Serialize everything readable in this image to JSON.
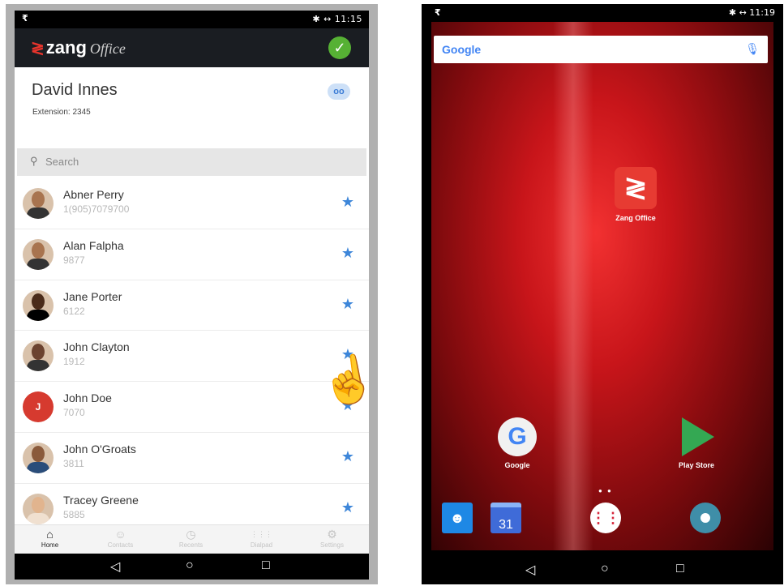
{
  "left_phone": {
    "status_time": "11:15",
    "status_icons": "✱ ↔",
    "app_logo": "zang",
    "app_logo_suffix": "Office",
    "profile": {
      "name": "David Innes",
      "extension": "Extension: 2345",
      "voicemail_icon": "oo"
    },
    "search_placeholder": "Search",
    "contacts": [
      {
        "name": "Abner Perry",
        "number": "1(905)7079700",
        "avatar": "photo"
      },
      {
        "name": "Alan Falpha",
        "number": "9877",
        "avatar": "photo"
      },
      {
        "name": "Jane Porter",
        "number": "6122",
        "avatar": "photo"
      },
      {
        "name": "John Clayton",
        "number": "1912",
        "avatar": "photo"
      },
      {
        "name": "John Doe",
        "number": "7070",
        "avatar": "J"
      },
      {
        "name": "John O'Groats",
        "number": "3811",
        "avatar": "photo"
      },
      {
        "name": "Tracey Greene",
        "number": "5885",
        "avatar": "photo"
      }
    ],
    "tabs": [
      {
        "label": "Home",
        "icon": "home-icon",
        "glyph": "⌂"
      },
      {
        "label": "Contacts",
        "icon": "person-icon",
        "glyph": "☺"
      },
      {
        "label": "Recents",
        "icon": "clock-icon",
        "glyph": "◷"
      },
      {
        "label": "Dialpad",
        "icon": "dialpad-icon",
        "glyph": "⋮⋮⋮"
      },
      {
        "label": "Settings",
        "icon": "gear-icon",
        "glyph": "⚙"
      }
    ]
  },
  "right_phone": {
    "status_time": "11:19",
    "status_icons": "✱ ↔",
    "search_label": "Google",
    "apps": {
      "zang_office": "Zang Office",
      "google": "Google",
      "play_store": "Play Store"
    },
    "calendar_day": "31"
  },
  "colors": {
    "accent_blue": "#3d86d9",
    "zang_red": "#e8342c",
    "status_green": "#56b134",
    "initial_avatar_red": "#d63a2f"
  }
}
